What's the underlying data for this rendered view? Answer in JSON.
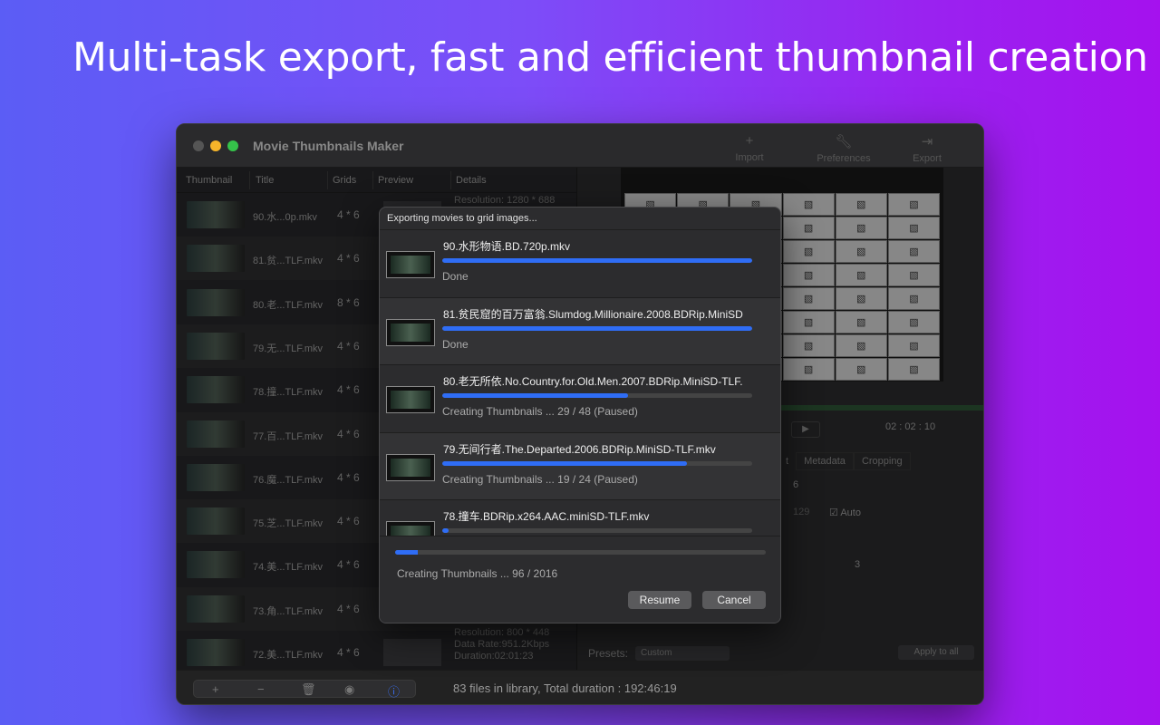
{
  "headline": "Multi-task export, fast and efficient thumbnail creation",
  "window": {
    "title": "Movie Thumbnails Maker",
    "toolbar": {
      "import": "Import",
      "preferences": "Preferences",
      "export": "Export"
    }
  },
  "columns": {
    "thumbnail": "Thumbnail",
    "title": "Title",
    "grids": "Grids",
    "preview": "Preview",
    "details": "Details"
  },
  "rows": [
    {
      "title": "90.水...0p.mkv",
      "grids": "4 * 6",
      "details": [
        "Resolution: 1280 * 688"
      ]
    },
    {
      "title": "81.贫...TLF.mkv",
      "grids": "4 * 6",
      "details": []
    },
    {
      "title": "80.老...TLF.mkv",
      "grids": "8 * 6",
      "details": []
    },
    {
      "title": "79.无...TLF.mkv",
      "grids": "4 * 6",
      "details": []
    },
    {
      "title": "78.撞...TLF.mkv",
      "grids": "4 * 6",
      "details": []
    },
    {
      "title": "77.百...TLF.mkv",
      "grids": "4 * 6",
      "details": []
    },
    {
      "title": "76.魔...TLF.mkv",
      "grids": "4 * 6",
      "details": []
    },
    {
      "title": "75.芝...TLF.mkv",
      "grids": "4 * 6",
      "details": []
    },
    {
      "title": "74.美...TLF.mkv",
      "grids": "4 * 6",
      "details": []
    },
    {
      "title": "73.角...TLF.mkv",
      "grids": "4 * 6",
      "details": []
    },
    {
      "title": "72.美...TLF.mkv",
      "grids": "4 * 6",
      "details": [
        "Resolution: 800 * 448",
        "Data Rate:951.2Kbps",
        "Duration:02:01:23"
      ]
    }
  ],
  "right_panel": {
    "time": [
      "02",
      "02",
      "10"
    ],
    "tabs": [
      "t",
      "Metadata",
      "Cropping"
    ],
    "value_6": "6",
    "value_129": "129",
    "auto_label": "Auto",
    "value_3": "3",
    "presets_label": "Presets:",
    "presets_value": "Custom",
    "apply_all": "Apply to all"
  },
  "status_bar": "83 files in library, Total duration : 192:46:19",
  "dialog": {
    "title": "Exporting movies to grid images...",
    "items": [
      {
        "name": "90.水形物语.BD.720p.mkv",
        "progress": 1.0,
        "status": "Done"
      },
      {
        "name": "81.贫民窟的百万富翁.Slumdog.Millionaire.2008.BDRip.MiniSD",
        "progress": 1.0,
        "status": "Done"
      },
      {
        "name": "80.老无所依.No.Country.for.Old.Men.2007.BDRip.MiniSD-TLF.",
        "progress": 0.6,
        "status": "Creating Thumbnails ... 29 / 48 (Paused)"
      },
      {
        "name": "79.无间行者.The.Departed.2006.BDRip.MiniSD-TLF.mkv",
        "progress": 0.79,
        "status": "Creating Thumbnails ... 19 / 24 (Paused)"
      },
      {
        "name": "78.撞车.BDRip.x264.AAC.miniSD-TLF.mkv",
        "progress": 0.02,
        "status": ""
      }
    ],
    "overall_progress": 0.06,
    "overall_status": "Creating Thumbnails ... 96 / 2016",
    "resume": "Resume",
    "cancel": "Cancel"
  },
  "colors": {
    "accent": "#2f6df5"
  }
}
